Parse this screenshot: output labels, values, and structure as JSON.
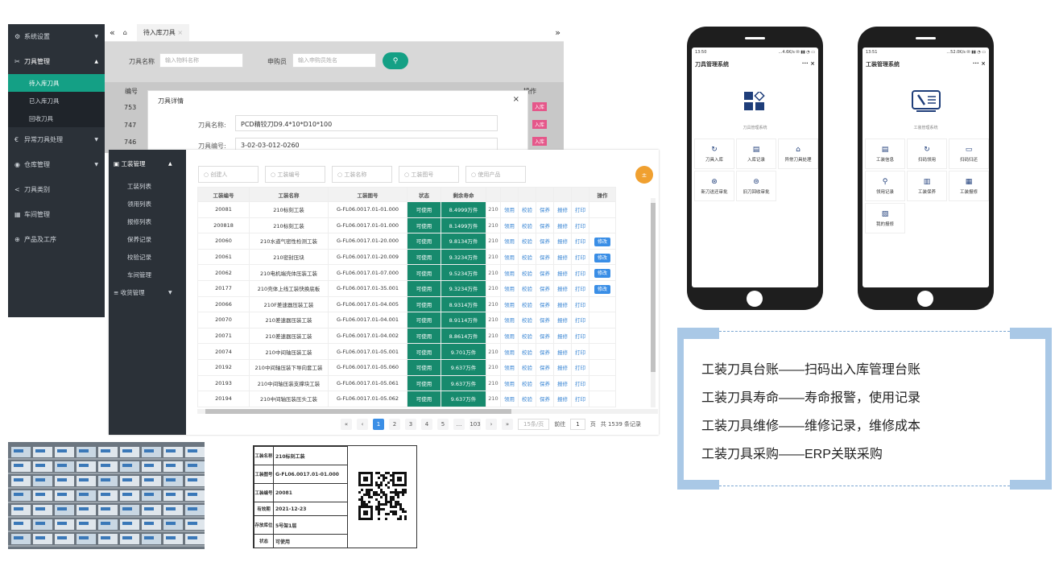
{
  "sidebar": {
    "items": [
      {
        "label": "系统设置",
        "icon": "gear-icon"
      },
      {
        "label": "刀具管理",
        "icon": "scissors-icon"
      },
      {
        "label": "异常刀具处理",
        "icon": "alert-icon"
      },
      {
        "label": "仓库管理",
        "icon": "warehouse-icon"
      },
      {
        "label": "刀具类别",
        "icon": "share-icon"
      },
      {
        "label": "车间管理",
        "icon": "workshop-icon"
      },
      {
        "label": "产品及工序",
        "icon": "product-icon"
      }
    ],
    "subitems": [
      "待入库刀具",
      "已入库刀具",
      "回收刀具"
    ]
  },
  "window1": {
    "tab": "待入库刀具",
    "filter_name_label": "刀具名称",
    "filter_name_ph": "输入物料名称",
    "filter_buyer_label": "申购员",
    "filter_buyer_ph": "输入申购员姓名",
    "col_id": "编号",
    "ids": [
      "753",
      "747",
      "746"
    ],
    "ops": [
      "入库",
      "入库",
      "入库"
    ],
    "op_header": "操作"
  },
  "dialog": {
    "title": "刀具详情",
    "name_label": "刀具名称:",
    "name_value": "PCD精铰刀D9.4*10*D10*100",
    "code_label": "刀具编号:",
    "code_value": "3-02-03-012-0260"
  },
  "main": {
    "sidebar_title": "工装管理",
    "sidebar_items": [
      "工装列表",
      "领用列表",
      "报修列表",
      "保养记录",
      "校验记录",
      "车间管理"
    ],
    "sidebar_bottom": "收货管理",
    "filters": [
      "创建人",
      "工装编号",
      "工装名称",
      "工装图号",
      "使用产品"
    ],
    "headers": [
      "工装编号",
      "工装名称",
      "工装图号",
      "状态",
      "剩余寿命",
      "",
      "",
      "",
      "",
      "",
      "",
      "操作"
    ],
    "actions": [
      "领用",
      "校验",
      "保养",
      "报修",
      "打印"
    ],
    "edit_label": "修改",
    "rows": [
      [
        "20081",
        "210标刻工装",
        "G-FL06.0017.01-01.000",
        "可使用",
        "8.4999万件",
        "210",
        false
      ],
      [
        "200818",
        "210标刻工装",
        "G-FL06.0017.01-01.000",
        "可使用",
        "8.1499万件",
        "210",
        false
      ],
      [
        "20060",
        "210水道气密性检测工装",
        "G-FL06.0017.01-20.000",
        "可使用",
        "9.8134万件",
        "210",
        true
      ],
      [
        "20061",
        "210密封压块",
        "G-FL06.0017.01-20.009",
        "可使用",
        "9.3234万件",
        "210",
        true
      ],
      [
        "20062",
        "210电机端壳体压装工装",
        "G-FL06.0017.01-07.000",
        "可使用",
        "9.5234万件",
        "210",
        true
      ],
      [
        "20177",
        "210壳体上线工装快换底板",
        "G-FL06.0017.01-35.001",
        "可使用",
        "9.3234万件",
        "210",
        true
      ],
      [
        "20066",
        "210F差速器压装工装",
        "G-FL06.0017.01-04.005",
        "可使用",
        "8.9314万件",
        "210",
        false
      ],
      [
        "20070",
        "210差速器压装工装",
        "G-FL06.0017.01-04.001",
        "可使用",
        "8.9114万件",
        "210",
        false
      ],
      [
        "20071",
        "210差速器压装工装",
        "G-FL06.0017.01-04.002",
        "可使用",
        "8.8614万件",
        "210",
        false
      ],
      [
        "20074",
        "210中间轴压装工装",
        "G-FL06.0017.01-05.001",
        "可使用",
        "9.701万件",
        "210",
        false
      ],
      [
        "20192",
        "210中间轴压装下导向套工装",
        "G-FL06.0017.01-05.060",
        "可使用",
        "9.637万件",
        "210",
        false
      ],
      [
        "20193",
        "210中间轴压装支撑块工装",
        "G-FL06.0017.01-05.061",
        "可使用",
        "9.637万件",
        "210",
        false
      ],
      [
        "20194",
        "210中间轴压装压头工装",
        "G-FL06.0017.01-05.062",
        "可使用",
        "9.637万件",
        "210",
        false
      ]
    ],
    "pager": {
      "pages": [
        "1",
        "2",
        "3",
        "4",
        "5",
        "…",
        "103"
      ],
      "per_page": "15条/页",
      "goto_label": "前往",
      "goto_value": "1",
      "page_unit": "页",
      "total": "共 1539 条记录"
    }
  },
  "phone1": {
    "time": "13:50",
    "status": "...4.6K/s ✉ ▮▮ ◔ ▭",
    "title": "刀具管理系统",
    "subtitle": "刀具管理系统",
    "tiles": [
      "刀具入库",
      "入库记录",
      "异常刀具处理",
      "新刀送还审批",
      "旧刀回收审批"
    ]
  },
  "phone2": {
    "time": "13:51",
    "status": "...52.0K/s ✉ ▮▮ ◔ ▭",
    "title": "工装管理系统",
    "subtitle": "工装管理系统",
    "tiles": [
      "工装信息",
      "扫码领用",
      "扫码归还",
      "领用记录",
      "工装保养",
      "工装报修",
      "我的报修"
    ]
  },
  "info": {
    "lines": [
      "工装刀具台账——扫码出入库管理台账",
      "工装刀具寿命——寿命报警，使用记录",
      "工装刀具维修——维修记录，维修成本",
      "工装刀具采购——ERP关联采购"
    ]
  },
  "label_card": {
    "rows": [
      [
        "工装名称",
        "210标刻工装"
      ],
      [
        "工装图号",
        "G-FL06.0017.01-01.000"
      ],
      [
        "工装编号",
        "20081"
      ],
      [
        "有效期",
        "2021-12-23"
      ],
      [
        "存放库位",
        "5号架1层"
      ],
      [
        "状态",
        "可使用"
      ]
    ]
  }
}
